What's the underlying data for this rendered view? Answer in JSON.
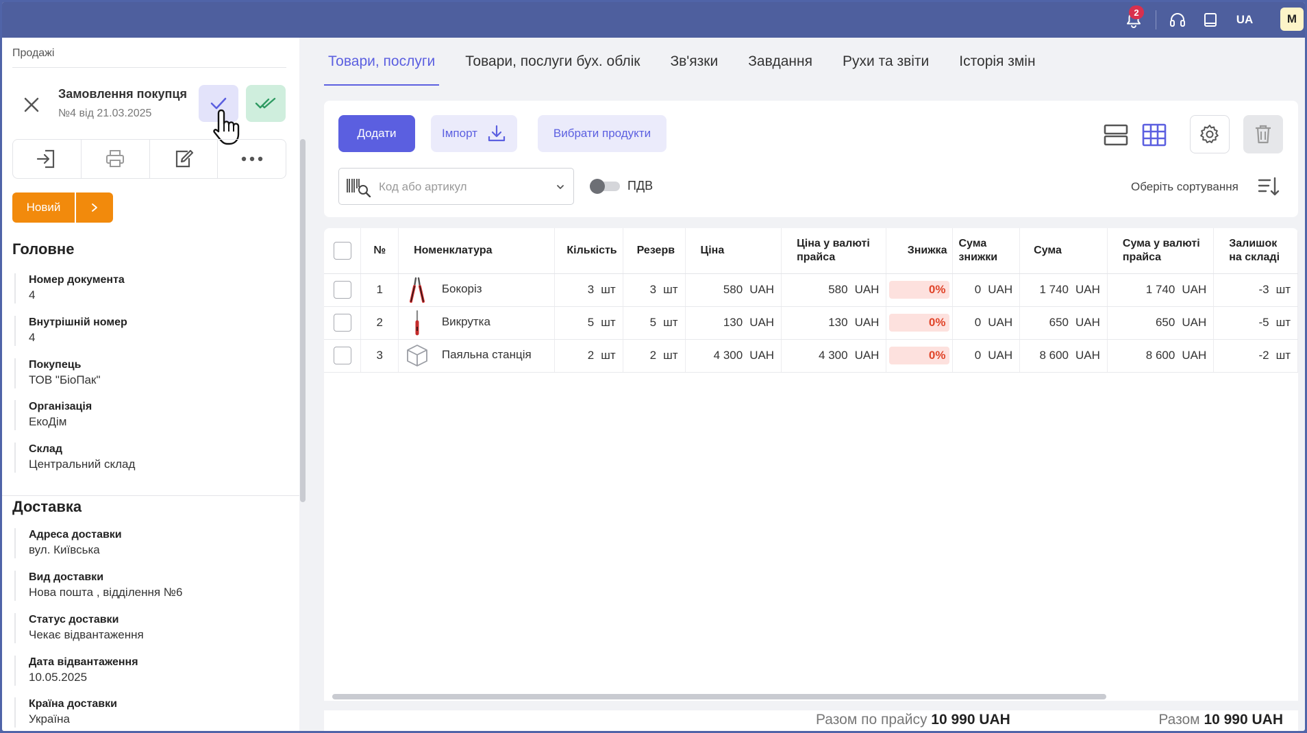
{
  "topbar": {
    "notifications_count": "2",
    "language": "UA",
    "avatar_initial": "M"
  },
  "left": {
    "breadcrumb": "Продажі",
    "doc_title": "Замовлення покупця",
    "doc_subtitle": "№4 від 21.03.2025",
    "status": "Новий",
    "main_section_title": "Головне",
    "main_fields": [
      {
        "label": "Номер документа",
        "value": "4"
      },
      {
        "label": "Внутрішній номер",
        "value": "4"
      },
      {
        "label": "Покупець",
        "value": "ТОВ \"БіоПак\""
      },
      {
        "label": "Організація",
        "value": "ЕкоДім"
      },
      {
        "label": "Склад",
        "value": "Центральний склад"
      }
    ],
    "delivery_section_title": "Доставка",
    "delivery_fields": [
      {
        "label": "Адреса доставки",
        "value": "вул. Київська"
      },
      {
        "label": "Вид доставки",
        "value": "Нова пошта , відділення №6"
      },
      {
        "label": "Статус доставки",
        "value": "Чекає відвантаження"
      },
      {
        "label": "Дата відвантаження",
        "value": "10.05.2025"
      },
      {
        "label": "Країна доставки",
        "value": "Україна"
      }
    ]
  },
  "tabs": [
    {
      "label": "Товари, послуги",
      "active": true
    },
    {
      "label": "Товари, послуги бух. облік"
    },
    {
      "label": "Зв'язки"
    },
    {
      "label": "Завдання"
    },
    {
      "label": "Рухи та звіти"
    },
    {
      "label": "Історія змін"
    }
  ],
  "toolbar": {
    "add_label": "Додати",
    "import_label": "Імпорт",
    "choose_label": "Вибрати продукти",
    "search_placeholder": "Код або артикул",
    "vat_label": "ПДВ",
    "sort_label": "Оберіть сортування"
  },
  "table": {
    "headers": {
      "no": "№",
      "name": "Номенклатура",
      "qty": "Кількість",
      "reserve": "Резерв",
      "price": "Ціна",
      "price_list": "Ціна у валюті прайса",
      "discount": "Знижка",
      "discount_sum": "Сума знижки",
      "sum": "Сума",
      "sum_list": "Сума у валюті прайса",
      "stock": "Залишок на складі"
    },
    "rows": [
      {
        "no": "1",
        "name": "Бокоріз",
        "icon": "pliers-icon",
        "qty": "3",
        "qty_unit": "шт",
        "reserve": "3",
        "reserve_unit": "шт",
        "price": "580",
        "price_cur": "UAH",
        "price_list": "580",
        "price_list_cur": "UAH",
        "discount": "0%",
        "discount_sum": "0",
        "discount_sum_cur": "UAH",
        "sum": "1 740",
        "sum_cur": "UAH",
        "sum_list": "1 740",
        "sum_list_cur": "UAH",
        "stock": "-3",
        "stock_unit": "шт"
      },
      {
        "no": "2",
        "name": "Викрутка",
        "icon": "screwdriver-icon",
        "qty": "5",
        "qty_unit": "шт",
        "reserve": "5",
        "reserve_unit": "шт",
        "price": "130",
        "price_cur": "UAH",
        "price_list": "130",
        "price_list_cur": "UAH",
        "discount": "0%",
        "discount_sum": "0",
        "discount_sum_cur": "UAH",
        "sum": "650",
        "sum_cur": "UAH",
        "sum_list": "650",
        "sum_list_cur": "UAH",
        "stock": "-5",
        "stock_unit": "шт"
      },
      {
        "no": "3",
        "name": "Паяльна станція",
        "icon": "box-icon",
        "qty": "2",
        "qty_unit": "шт",
        "reserve": "2",
        "reserve_unit": "шт",
        "price": "4 300",
        "price_cur": "UAH",
        "price_list": "4 300",
        "price_list_cur": "UAH",
        "discount": "0%",
        "discount_sum": "0",
        "discount_sum_cur": "UAH",
        "sum": "8 600",
        "sum_cur": "UAH",
        "sum_list": "8 600",
        "sum_list_cur": "UAH",
        "stock": "-2",
        "stock_unit": "шт"
      }
    ]
  },
  "totals": {
    "list_label": "Разом по прайсу",
    "list_value": "10 990 UAH",
    "total_label": "Разом",
    "total_value": "10 990 UAH"
  },
  "colors": {
    "accent": "#5b5fe0",
    "topbar": "#4e5f9e",
    "status": "#f28a0c",
    "discount_bg": "#fde1de"
  }
}
